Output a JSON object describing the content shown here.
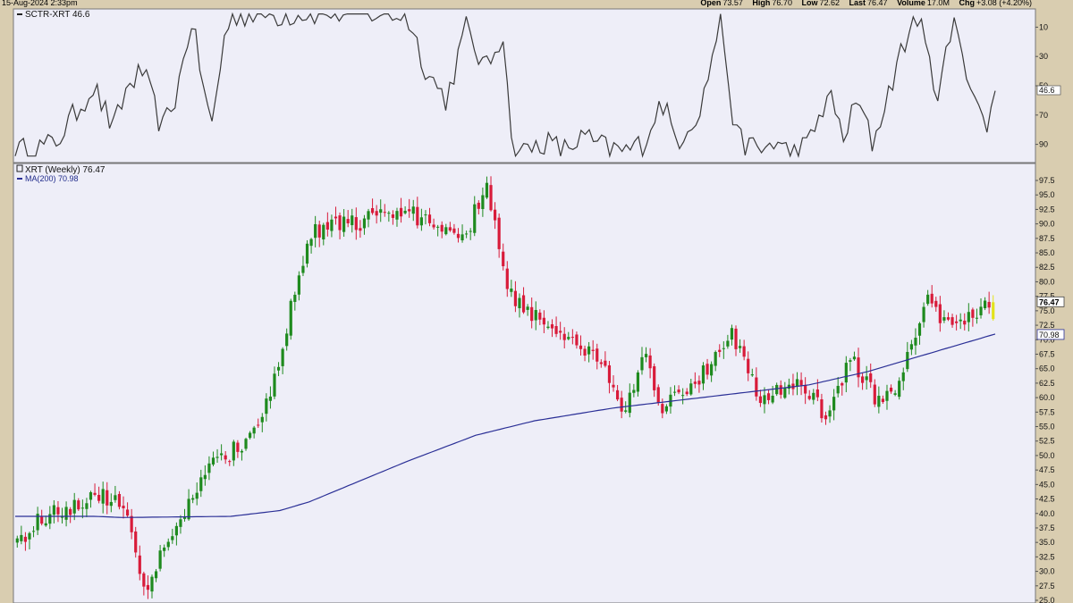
{
  "header": {
    "date": "15-Aug-2024 2:33pm",
    "open_label": "Open",
    "open_value": "73.57",
    "high_label": "High",
    "high_value": "76.70",
    "low_label": "Low",
    "low_value": "72.62",
    "last_label": "Last",
    "last_value": "76.47",
    "volume_label": "Volume",
    "volume_value": "17.0M",
    "chg_label": "Chg",
    "chg_value": "+3.08 (+4.20%)"
  },
  "colors": {
    "background": "#d9cdb0",
    "panel": "#eeeef8",
    "up_candle": "#1e8a1e",
    "down_candle": "#d81b3a",
    "ma_line": "#2a2f96",
    "sctr_line": "#3a3a3a",
    "last_candle": "#e3e31a"
  },
  "sctr_panel": {
    "label": "SCTR-XRT 46.6",
    "value_tag": "46.6",
    "ticks": [
      "90",
      "70",
      "50",
      "30",
      "10"
    ]
  },
  "price_panel": {
    "legend_symbol": "XRT (Weekly) 76.47",
    "legend_ma": "MA(200) 70.98",
    "last_tag": "76.47",
    "ma_tag": "70.98",
    "ticks": [
      "97.5",
      "95.0",
      "92.5",
      "90.0",
      "87.5",
      "85.0",
      "82.5",
      "80.0",
      "77.5",
      "75.0",
      "72.5",
      "70.0",
      "67.5",
      "65.0",
      "62.5",
      "60.0",
      "57.5",
      "55.0",
      "52.5",
      "50.0",
      "47.5",
      "45.0",
      "42.5",
      "40.0",
      "37.5",
      "35.0",
      "32.5",
      "30.0",
      "27.5",
      "25.0"
    ]
  },
  "chart_data": [
    {
      "type": "line",
      "name": "SCTR-XRT",
      "ylim": [
        0,
        100
      ],
      "y_ticks": [
        10,
        30,
        50,
        70,
        90
      ],
      "last_value": 46.6,
      "keypoints_t": [
        0,
        0.04,
        0.06,
        0.08,
        0.1,
        0.115,
        0.13,
        0.15,
        0.165,
        0.18,
        0.2,
        0.215,
        0.225,
        0.25,
        0.27,
        0.3,
        0.35,
        0.4,
        0.42,
        0.44,
        0.46,
        0.48,
        0.5,
        0.505,
        0.52,
        0.54,
        0.56,
        0.58,
        0.6,
        0.62,
        0.64,
        0.66,
        0.675,
        0.7,
        0.72,
        0.735,
        0.76,
        0.775,
        0.79,
        0.81,
        0.83,
        0.845,
        0.86,
        0.875,
        0.9,
        0.92,
        0.94,
        0.96,
        0.975,
        0.99,
        1.0
      ],
      "keypoints_v": [
        5,
        10,
        30,
        50,
        20,
        50,
        60,
        20,
        45,
        95,
        20,
        90,
        98,
        100,
        98,
        100,
        100,
        98,
        60,
        40,
        90,
        60,
        90,
        10,
        5,
        12,
        6,
        15,
        8,
        5,
        10,
        40,
        12,
        35,
        98,
        15,
        5,
        12,
        4,
        10,
        45,
        15,
        40,
        10,
        65,
        100,
        45,
        95,
        50,
        20,
        46.6
      ]
    },
    {
      "type": "candlestick",
      "name": "XRT (Weekly)",
      "ylim": [
        25,
        97.5
      ],
      "y_tick_step": 2.5,
      "last_close": 76.47,
      "close_keypoints_t": [
        0,
        0.03,
        0.09,
        0.115,
        0.125,
        0.135,
        0.16,
        0.2,
        0.23,
        0.26,
        0.28,
        0.3,
        0.32,
        0.34,
        0.4,
        0.46,
        0.48,
        0.505,
        0.54,
        0.57,
        0.6,
        0.62,
        0.645,
        0.66,
        0.71,
        0.73,
        0.76,
        0.8,
        0.83,
        0.855,
        0.88,
        0.9,
        0.93,
        0.96,
        1.0
      ],
      "close_keypoints_v": [
        35,
        40,
        43,
        40,
        30,
        27,
        38,
        48,
        52,
        60,
        75,
        88,
        90,
        90,
        92,
        88,
        97,
        78,
        73,
        70,
        66,
        58,
        68,
        58,
        65,
        72,
        60,
        62,
        57,
        67,
        60,
        60,
        77,
        72,
        76.47
      ],
      "ma200_keypoints_t": [
        0,
        0.08,
        0.11,
        0.22,
        0.27,
        0.3,
        0.4,
        0.47,
        0.53,
        0.61,
        0.7,
        0.81,
        0.87,
        0.93,
        1.0
      ],
      "ma200_keypoints_v": [
        39.5,
        39.5,
        39.3,
        39.5,
        40.5,
        42.0,
        49.0,
        53.5,
        56.0,
        58.2,
        60.0,
        62.2,
        64.5,
        67.5,
        70.98
      ]
    }
  ]
}
